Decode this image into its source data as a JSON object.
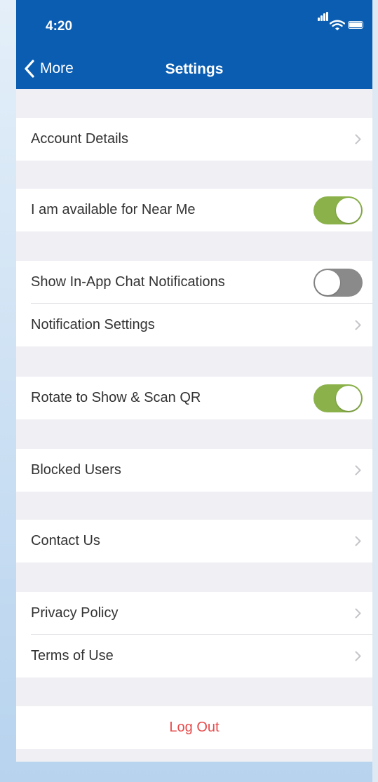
{
  "status_bar": {
    "time": "4:20"
  },
  "nav": {
    "back_label": "More",
    "title": "Settings"
  },
  "rows": {
    "account_details": "Account Details",
    "near_me": {
      "label": "I am available for Near Me",
      "enabled": true
    },
    "chat_notifications": {
      "label": "Show In-App Chat Notifications",
      "enabled": false
    },
    "notification_settings": "Notification Settings",
    "rotate_qr": {
      "label": "Rotate to Show & Scan QR",
      "enabled": true
    },
    "blocked_users": "Blocked Users",
    "contact_us": "Contact Us",
    "privacy_policy": "Privacy Policy",
    "terms_of_use": "Terms of Use",
    "log_out": "Log Out"
  },
  "colors": {
    "nav_bar": "#0a5db1",
    "toggle_on": "#8bb24a",
    "toggle_off": "#8a8a8a",
    "log_out_text": "#e84a4a",
    "page_background": "#efeff4"
  }
}
